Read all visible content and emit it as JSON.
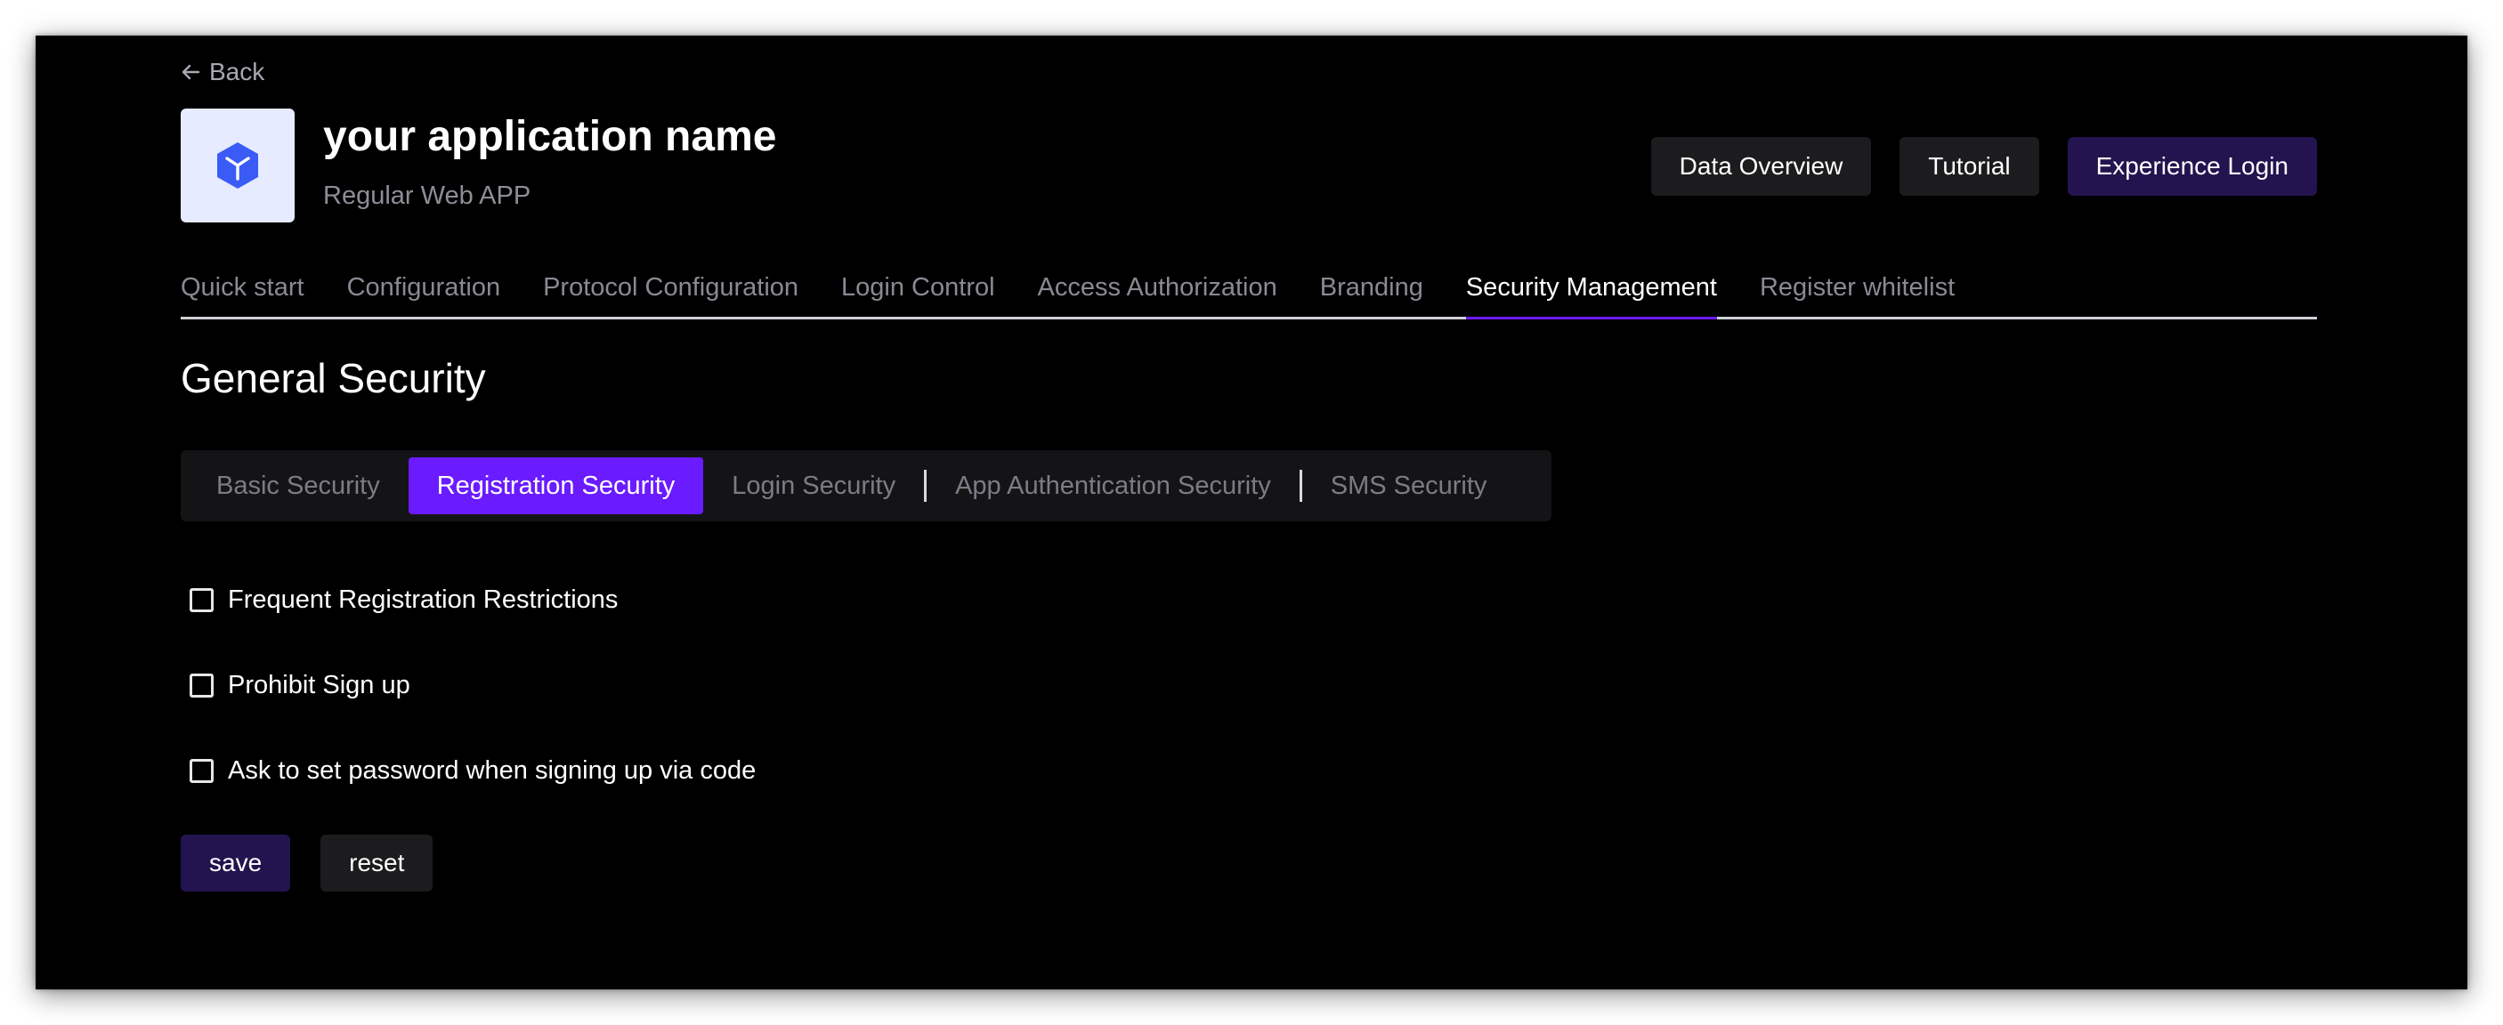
{
  "nav": {
    "back_label": "Back"
  },
  "app": {
    "name": "your application name",
    "type": "Regular Web APP",
    "logo_icon": "cube-icon",
    "logo_color": "#3b5bf6"
  },
  "header_actions": {
    "data_overview": "Data Overview",
    "tutorial": "Tutorial",
    "experience_login": "Experience Login"
  },
  "main_tabs": [
    {
      "label": "Quick start",
      "active": false
    },
    {
      "label": "Configuration",
      "active": false
    },
    {
      "label": "Protocol Configuration",
      "active": false
    },
    {
      "label": "Login Control",
      "active": false
    },
    {
      "label": "Access Authorization",
      "active": false
    },
    {
      "label": "Branding",
      "active": false
    },
    {
      "label": "Security Management",
      "active": true
    },
    {
      "label": "Register whitelist",
      "active": false
    }
  ],
  "section": {
    "title": "General Security"
  },
  "sub_tabs": [
    {
      "label": "Basic Security",
      "active": false
    },
    {
      "label": "Registration Security",
      "active": true
    },
    {
      "label": "Login Security",
      "active": false
    },
    {
      "label": "App Authentication Security",
      "active": false
    },
    {
      "label": "SMS Security",
      "active": false
    }
  ],
  "options": [
    {
      "label": "Frequent Registration Restrictions",
      "checked": false
    },
    {
      "label": "Prohibit Sign up",
      "checked": false
    },
    {
      "label": "Ask to set password when signing up via code",
      "checked": false
    }
  ],
  "form_actions": {
    "save": "save",
    "reset": "reset"
  },
  "colors": {
    "accent": "#6a1bff",
    "primary_button": "#23144f",
    "secondary_button": "#1c1c1e",
    "background": "#000000"
  }
}
